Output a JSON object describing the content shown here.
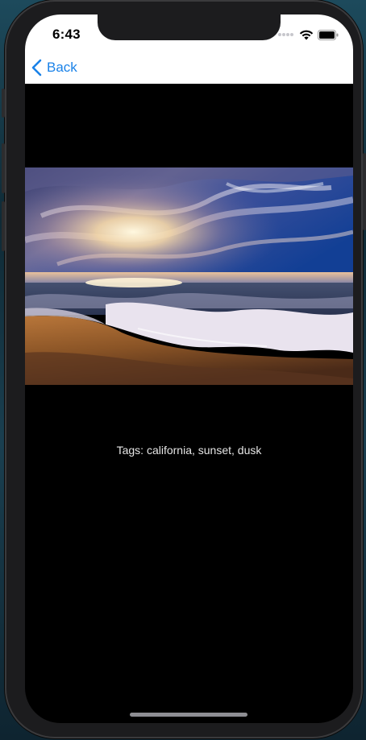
{
  "status_bar": {
    "time": "6:43",
    "icons": [
      "signal-dots-icon",
      "wifi-icon",
      "battery-icon"
    ]
  },
  "nav": {
    "back_label": "Back",
    "accent": "#1a82e8"
  },
  "image": {
    "subject": "beach-sunset-photo"
  },
  "tags_text": "Tags: california, sunset, dusk"
}
